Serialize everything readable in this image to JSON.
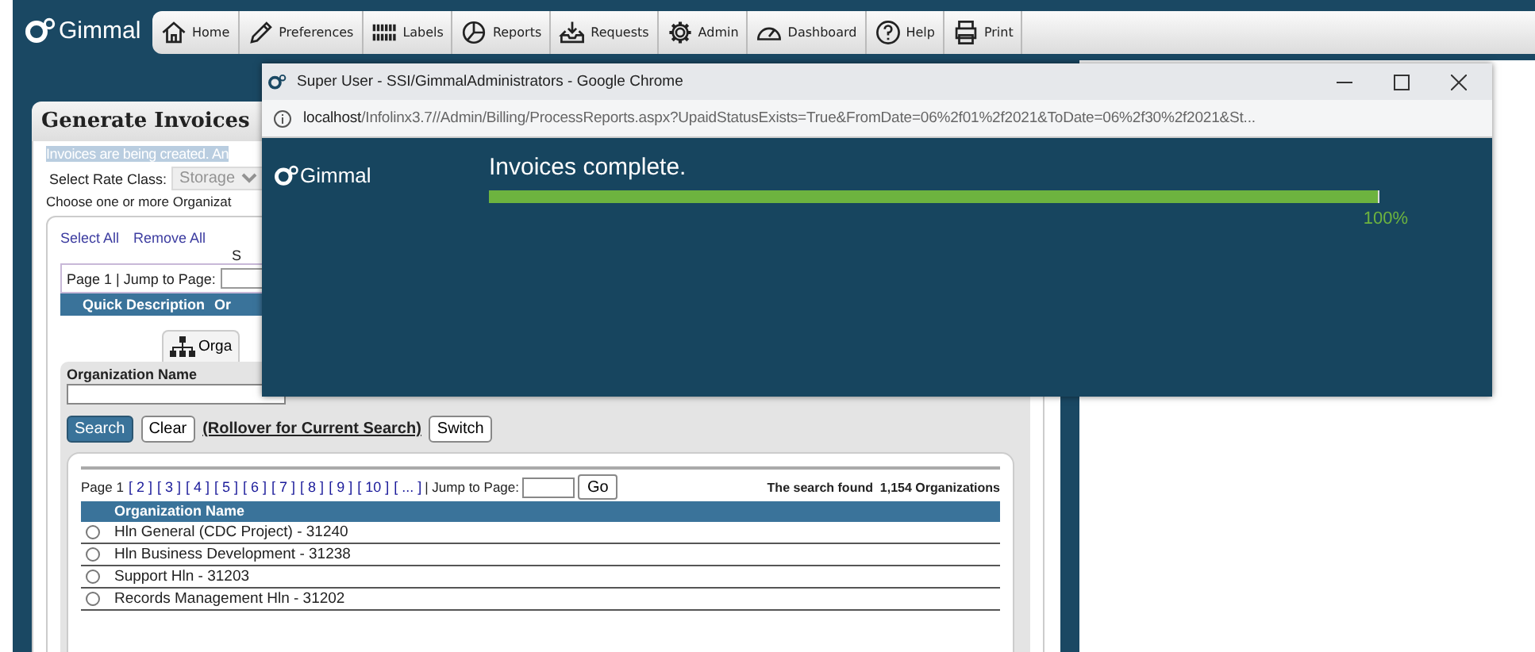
{
  "app": {
    "logo": "Gimmal"
  },
  "nav": [
    {
      "label": "Home",
      "kind": "home"
    },
    {
      "label": "Preferences",
      "kind": "pencil"
    },
    {
      "label": "Labels",
      "kind": "barcode"
    },
    {
      "label": "Reports",
      "kind": "pie"
    },
    {
      "label": "Requests",
      "kind": "tray"
    },
    {
      "label": "Admin",
      "kind": "gear"
    },
    {
      "label": "Dashboard",
      "kind": "gauge"
    },
    {
      "label": "Help",
      "kind": "question"
    },
    {
      "label": "Print",
      "kind": "printer"
    }
  ],
  "panel": {
    "title": "Generate Invoices",
    "notice": "Invoices are being created. An",
    "rate_class_label": "Select Rate Class:",
    "rate_class_value": "Storage",
    "rate_class_disabled": true,
    "choose_text": "Choose one or more Organizat",
    "selection": {
      "links": [
        "Select All",
        "Remove All"
      ],
      "heading_fragment": "S",
      "pager": "Page 1 | Jump to Page:",
      "columns": [
        "Quick Description",
        "Or"
      ]
    },
    "tab": {
      "label": "Orga"
    },
    "search": {
      "label": "Organization Name",
      "buttons": [
        {
          "label": "Search",
          "kind": "primary"
        },
        {
          "label": "Clear",
          "kind": "plain"
        }
      ],
      "rollover_link": "(Rollover for Current Search)",
      "switch_button": "Switch"
    },
    "results": {
      "page_label": "Page 1",
      "pages": [
        "[ 2 ]",
        "[ 3 ]",
        "[ 4 ]",
        "[ 5 ]",
        "[ 6 ]",
        "[ 7 ]",
        "[ 8 ]",
        "[ 9 ]",
        "[ 10 ]",
        "[ ... ]"
      ],
      "jump_label": "| Jump to Page:",
      "go_button": "Go",
      "found_text": "The search found  1,154 Organizations",
      "column": "Organization Name",
      "rows": [
        {
          "name": "Hln General (CDC Project) - 31240",
          "selected": false
        },
        {
          "name": "Hln Business Development - 31238",
          "selected": false
        },
        {
          "name": "Support Hln - 31203",
          "selected": false
        },
        {
          "name": "Records Management Hln - 31202",
          "selected": false
        }
      ]
    }
  },
  "popup": {
    "title": "Super User - SSI/GimmalAdministrators - Google Chrome",
    "url_host": "localhost",
    "url_rest": "/Infolinx3.7//Admin/Billing/ProcessReports.aspx?UpaidStatusExists=True&FromDate=06%2f01%2f2021&ToDate=06%2f30%2f2021&St...",
    "logo": "Gimmal",
    "message": "Invoices complete.",
    "level": 1,
    "percent": "100%"
  }
}
